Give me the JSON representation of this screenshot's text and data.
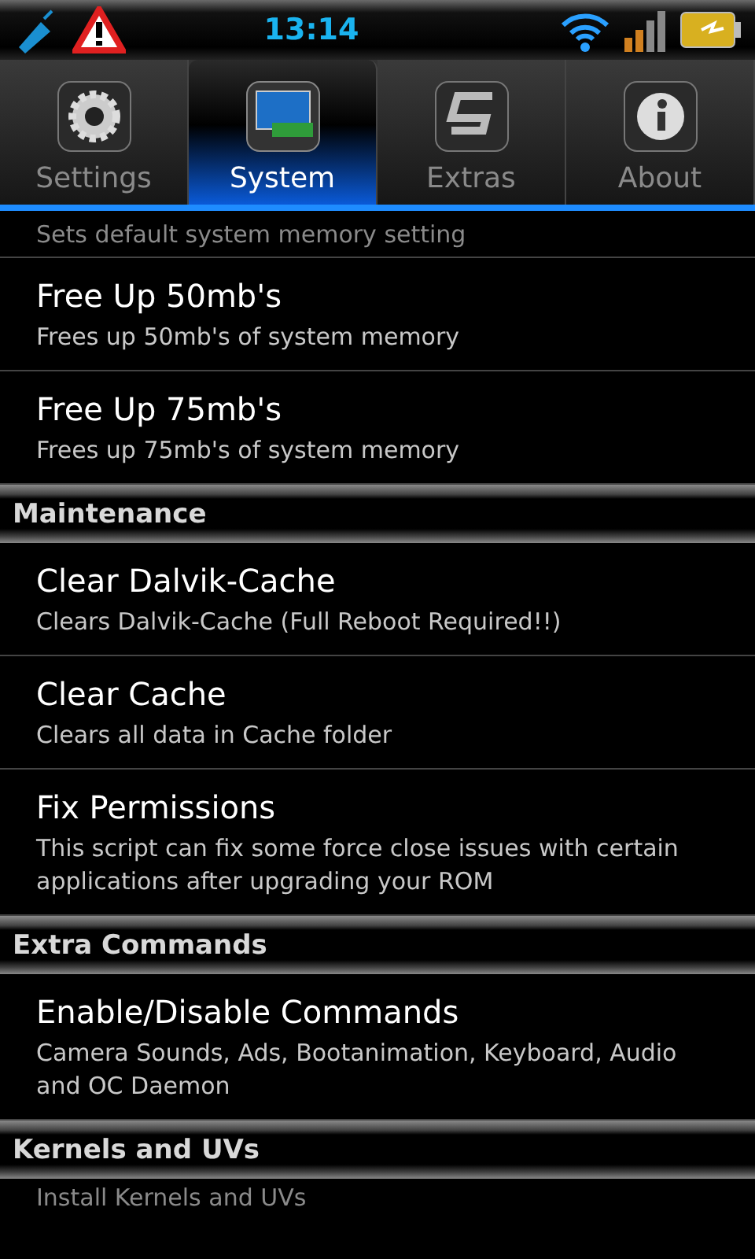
{
  "status_bar": {
    "time": "13:14"
  },
  "tabs": [
    {
      "label": "Settings",
      "selected": false,
      "kind": "gear"
    },
    {
      "label": "System",
      "selected": true,
      "kind": "monitor"
    },
    {
      "label": "Extras",
      "selected": false,
      "kind": "logo"
    },
    {
      "label": "About",
      "selected": false,
      "kind": "info"
    }
  ],
  "list": [
    {
      "kind": "partial",
      "text": "Sets default system memory setting"
    },
    {
      "kind": "item",
      "title": "Free Up 50mb's",
      "summary": "Frees up 50mb's of system memory"
    },
    {
      "kind": "item",
      "title": "Free Up 75mb's",
      "summary": "Frees up 75mb's of system memory"
    },
    {
      "kind": "header",
      "title": "Maintenance"
    },
    {
      "kind": "item",
      "title": "Clear Dalvik-Cache",
      "summary": "Clears Dalvik-Cache (Full Reboot Required!!)"
    },
    {
      "kind": "item",
      "title": "Clear Cache",
      "summary": "Clears all data in Cache folder"
    },
    {
      "kind": "item",
      "title": "Fix Permissions",
      "summary": "This script can fix some force close issues with certain applications after upgrading your ROM"
    },
    {
      "kind": "header",
      "title": "Extra Commands"
    },
    {
      "kind": "item",
      "title": "Enable/Disable Commands",
      "summary": "Camera Sounds, Ads, Bootanimation, Keyboard, Audio and OC Daemon"
    },
    {
      "kind": "header",
      "title": "Kernels and UVs"
    },
    {
      "kind": "partial",
      "text": "Install Kernels and UVs"
    }
  ]
}
